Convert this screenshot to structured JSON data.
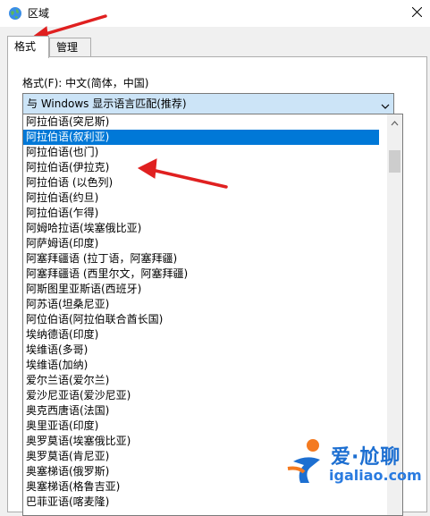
{
  "window": {
    "title": "区域",
    "icon": "globe-region-icon",
    "close_icon": "close-icon"
  },
  "tabs": [
    {
      "label": "格式",
      "active": true
    },
    {
      "label": "管理",
      "active": false
    }
  ],
  "format": {
    "label": "格式(F): 中文(简体，中国)",
    "combo_value": "与 Windows 显示语言匹配(推荐)"
  },
  "dropdown": {
    "items": [
      "阿拉伯语(突尼斯)",
      "阿拉伯语(叙利亚)",
      "阿拉伯语(也门)",
      "阿拉伯语(伊拉克)",
      "阿拉伯语 (以色列)",
      "阿拉伯语(约旦)",
      "阿拉伯语(乍得)",
      "阿姆哈拉语(埃塞俄比亚)",
      "阿萨姆语(印度)",
      "阿塞拜疆语 (拉丁语，阿塞拜疆)",
      "阿塞拜疆语 (西里尔文，阿塞拜疆)",
      "阿斯图里亚斯语(西班牙)",
      "阿苏语(坦桑尼亚)",
      "阿位伯语(阿拉伯联合酋长国)",
      "埃纳德语(印度)",
      "埃维语(多哥)",
      "埃维语(加纳)",
      "爱尔兰语(爱尔兰)",
      "爱沙尼亚语(爱沙尼亚)",
      "奥克西唐语(法国)",
      "奥里亚语(印度)",
      "奥罗莫语(埃塞俄比亚)",
      "奥罗莫语(肯尼亚)",
      "奥塞梯语(俄罗斯)",
      "奥塞梯语(格鲁吉亚)",
      "巴菲亚语(喀麦隆)"
    ],
    "selected_index": 1
  },
  "watermark": {
    "brand": "爱·尬聊",
    "domain": "igaliao.com"
  },
  "colors": {
    "selection": "#0078d7",
    "combo_bg": "#cce4f7",
    "annotation_arrow": "#e02020"
  }
}
